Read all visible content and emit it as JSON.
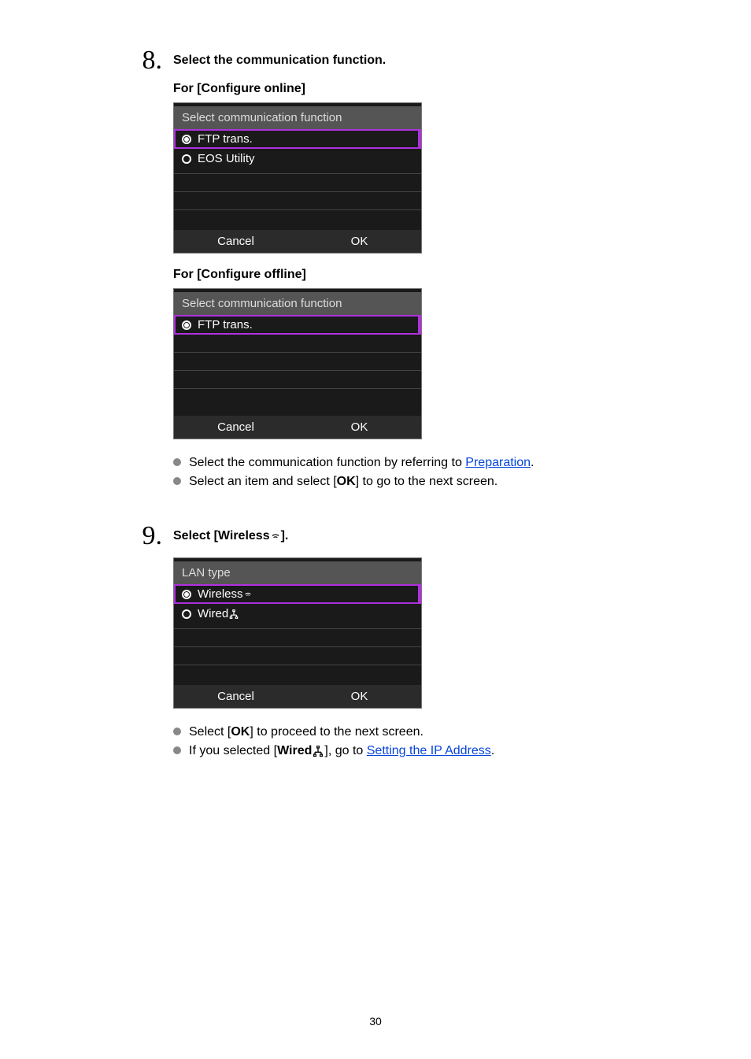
{
  "step8": {
    "number": "8.",
    "title": "Select the communication function.",
    "sub_online": "For [Configure online]",
    "sub_offline": "For [Configure offline]",
    "screen_online": {
      "header": "Select communication function",
      "item1": "FTP trans.",
      "item2": "EOS Utility",
      "cancel": "Cancel",
      "ok": "OK"
    },
    "screen_offline": {
      "header": "Select communication function",
      "item1": "FTP trans.",
      "cancel": "Cancel",
      "ok": "OK"
    },
    "bullets": {
      "b1_pre": "Select the communication function by referring to ",
      "b1_link": "Preparation",
      "b1_post": ".",
      "b2_pre": "Select an item and select [",
      "b2_bold": "OK",
      "b2_post": "] to go to the next screen."
    }
  },
  "step9": {
    "number": "9.",
    "title_pre": "Select [Wireless",
    "title_post": "].",
    "screen": {
      "header": "LAN type",
      "item1": "Wireless",
      "item2": "Wired",
      "cancel": "Cancel",
      "ok": "OK"
    },
    "bullets": {
      "b1_pre": "Select [",
      "b1_bold": "OK",
      "b1_post": "] to proceed to the next screen.",
      "b2_pre": "If you selected [",
      "b2_bold": "Wired",
      "b2_mid": "], go to ",
      "b2_link": "Setting the IP Address",
      "b2_post": "."
    }
  },
  "page_number": "30"
}
